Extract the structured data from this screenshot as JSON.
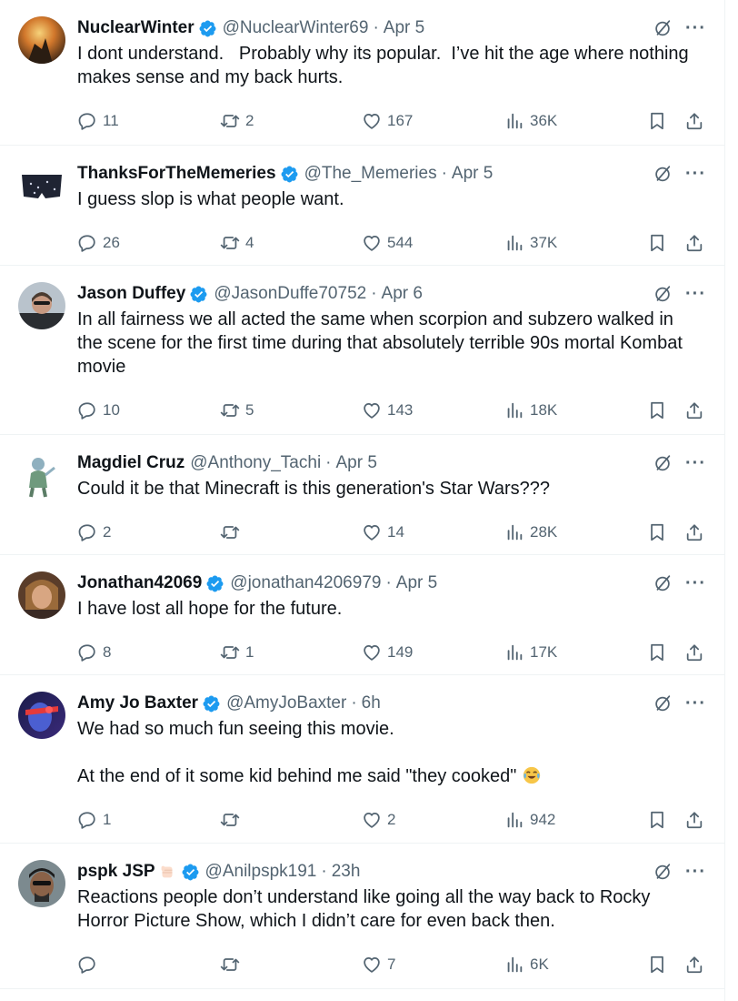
{
  "colors": {
    "verified": "#1d9bf0",
    "secondary_text": "#536471",
    "primary_text": "#0f1419",
    "divider": "#eff3f4"
  },
  "icons": [
    "reply-icon",
    "retweet-icon",
    "like-icon",
    "views-icon",
    "bookmark-icon",
    "share-icon",
    "grok-icon",
    "more-icon",
    "verified-badge-icon"
  ],
  "tweets": [
    {
      "name": "NuclearWinter",
      "handle": "@NuclearWinter69",
      "sep": "·",
      "time": "Apr 5",
      "text": "I dont understand.   Probably why its popular.  I’ve hit the age where nothing makes sense and my back hurts.",
      "replies": "11",
      "reposts": "2",
      "likes": "167",
      "views": "36K"
    },
    {
      "name": "ThanksForTheMemeries",
      "handle": "@The_Memeries",
      "sep": "·",
      "time": "Apr 5",
      "text": "I guess slop is what people want.",
      "replies": "26",
      "reposts": "4",
      "likes": "544",
      "views": "37K"
    },
    {
      "name": "Jason Duffey",
      "handle": "@JasonDuffe70752",
      "sep": "·",
      "time": "Apr 6",
      "text": "In all fairness we all acted the same when scorpion and subzero walked in the scene for the first time during that absolutely terrible 90s mortal Kombat movie",
      "replies": "10",
      "reposts": "5",
      "likes": "143",
      "views": "18K"
    },
    {
      "name": "Magdiel Cruz",
      "handle": "@Anthony_Tachi",
      "sep": "·",
      "time": "Apr 5",
      "text": "Could it be that Minecraft is this generation's Star Wars???",
      "replies": "2",
      "reposts": "",
      "likes": "14",
      "views": "28K"
    },
    {
      "name": "Jonathan42069",
      "handle": "@jonathan4206979",
      "sep": "·",
      "time": "Apr 5",
      "text": "I have lost all hope for the future.",
      "replies": "8",
      "reposts": "1",
      "likes": "149",
      "views": "17K"
    },
    {
      "name": "Amy Jo Baxter",
      "handle": "@AmyJoBaxter",
      "sep": "·",
      "time": "6h",
      "text": "We had so much fun seeing this movie.\n\nAt the end of it some kid behind me said \"they cooked\"",
      "replies": "1",
      "reposts": "",
      "likes": "2",
      "views": "942"
    },
    {
      "name": "pspk JSP",
      "handle": "@Anilpspk191",
      "sep": "·",
      "time": "23h",
      "text": "Reactions people don’t understand like going all the way back to Rocky Horror Picture Show, which I didn’t care for even back then.",
      "replies": "",
      "reposts": "",
      "likes": "7",
      "views": "6K"
    }
  ]
}
